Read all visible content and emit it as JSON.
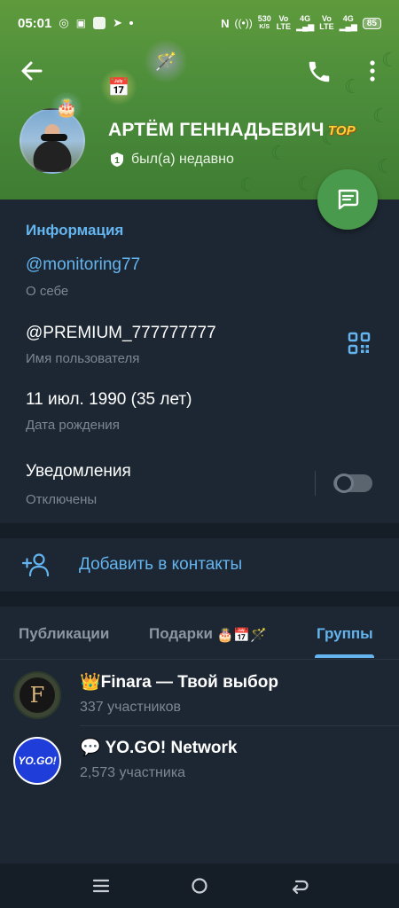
{
  "status_bar": {
    "time": "05:01",
    "net_speed_top": "530",
    "net_speed_unit": "K/S",
    "sim1": "Vo",
    "sim1_sub": "LTE",
    "sim1_gen": "4G",
    "sim2": "Vo",
    "sim2_sub": "LTE",
    "sim2_gen": "4G",
    "battery": "85"
  },
  "profile": {
    "name": "АРТЁМ ГЕННАДЬЕВИЧ",
    "badge": "TOP",
    "status": "был(а) недавно",
    "status_badge_num": "1"
  },
  "info": {
    "section_title": "Информация",
    "bio_value": "@monitoring77",
    "bio_label": "О себе",
    "username_value": "@PREMIUM_777777777",
    "username_label": "Имя пользователя",
    "birthday_value": "11 июл. 1990 (35 лет)",
    "birthday_label": "Дата рождения",
    "notifications_value": "Уведомления",
    "notifications_label": "Отключены",
    "notifications_on": false
  },
  "add_contact": {
    "label": "Добавить в контакты"
  },
  "tabs": [
    {
      "label": "Публикации",
      "active": false
    },
    {
      "label": "Подарки",
      "active": false
    },
    {
      "label": "Группы",
      "active": true
    }
  ],
  "groups": [
    {
      "title": "👑Finara — Твой выбор",
      "subtitle": "337 участников",
      "avatar_text": "F"
    },
    {
      "title": "💬 YO.GO! Network",
      "subtitle": "2,573 участника",
      "avatar_text": "YO.GO!"
    }
  ],
  "colors": {
    "header_green": "#4c8d3b",
    "accent_blue": "#64b5ef",
    "background": "#1d2733",
    "fab_green": "#4a9a4d"
  }
}
